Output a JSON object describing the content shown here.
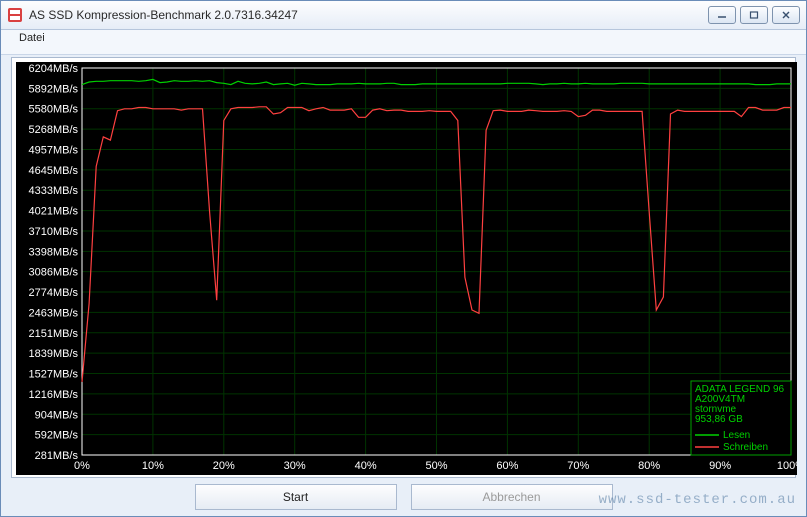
{
  "window": {
    "title": "AS SSD Kompression-Benchmark 2.0.7316.34247"
  },
  "menu": {
    "file": "Datei"
  },
  "buttons": {
    "start": "Start",
    "cancel": "Abbrechen"
  },
  "legend": {
    "device": "ADATA LEGEND 96",
    "model": "A200V4TM",
    "driver": "stornvme",
    "capacity": "953,86 GB",
    "read": "Lesen",
    "write": "Schreiben",
    "read_color": "#00d000",
    "write_color": "#ff4040",
    "grid_color": "#003300"
  },
  "watermark": "www.ssd-tester.com.au",
  "chart_data": {
    "type": "line",
    "xlabel": "",
    "ylabel": "",
    "x_ticks": [
      "0%",
      "10%",
      "20%",
      "30%",
      "40%",
      "50%",
      "60%",
      "70%",
      "80%",
      "90%",
      "100%"
    ],
    "y_ticks": [
      "281MB/s",
      "592MB/s",
      "904MB/s",
      "1216MB/s",
      "1527MB/s",
      "1839MB/s",
      "2151MB/s",
      "2463MB/s",
      "2774MB/s",
      "3086MB/s",
      "3398MB/s",
      "3710MB/s",
      "4021MB/s",
      "4333MB/s",
      "4645MB/s",
      "4957MB/s",
      "5268MB/s",
      "5580MB/s",
      "5892MB/s",
      "6204MB/s"
    ],
    "ylim": [
      281,
      6204
    ],
    "xlim": [
      0,
      100
    ],
    "x": [
      0,
      1,
      2,
      3,
      4,
      5,
      6,
      7,
      8,
      9,
      10,
      11,
      12,
      13,
      14,
      15,
      16,
      17,
      18,
      19,
      20,
      21,
      22,
      23,
      24,
      25,
      26,
      27,
      28,
      29,
      30,
      31,
      32,
      33,
      34,
      35,
      36,
      37,
      38,
      39,
      40,
      41,
      42,
      43,
      44,
      45,
      46,
      47,
      48,
      49,
      50,
      51,
      52,
      53,
      54,
      55,
      56,
      57,
      58,
      59,
      60,
      61,
      62,
      63,
      64,
      65,
      66,
      67,
      68,
      69,
      70,
      71,
      72,
      73,
      74,
      75,
      76,
      77,
      78,
      79,
      80,
      81,
      82,
      83,
      84,
      85,
      86,
      87,
      88,
      89,
      90,
      91,
      92,
      93,
      94,
      95,
      96,
      97,
      98,
      99,
      100
    ],
    "series": [
      {
        "name": "Lesen",
        "color": "#00d000",
        "values": [
          5950,
          5990,
          6000,
          6000,
          6010,
          6010,
          6010,
          6010,
          6000,
          6010,
          6030,
          5980,
          5990,
          6010,
          6000,
          6000,
          6010,
          6000,
          6010,
          5980,
          5970,
          5950,
          6000,
          5970,
          5960,
          5970,
          5990,
          5950,
          5960,
          5970,
          5940,
          5970,
          5960,
          5950,
          5950,
          5950,
          5960,
          5960,
          5960,
          5970,
          5960,
          5960,
          5960,
          5970,
          5970,
          5950,
          5950,
          5950,
          5960,
          5960,
          5960,
          5960,
          5960,
          5960,
          5960,
          5960,
          5960,
          5960,
          5960,
          5960,
          5970,
          5970,
          5970,
          5970,
          5960,
          5950,
          5960,
          5960,
          5970,
          5960,
          5960,
          5970,
          5960,
          5960,
          5960,
          5960,
          5970,
          5970,
          5970,
          5970,
          5960,
          5960,
          5960,
          5960,
          5960,
          5960,
          5960,
          5960,
          5960,
          5960,
          5960,
          5960,
          5960,
          5960,
          5960,
          5950,
          5950,
          5950,
          5960,
          5960,
          5960
        ]
      },
      {
        "name": "Schreiben",
        "color": "#ff4040",
        "values": [
          1400,
          2600,
          4700,
          5150,
          5100,
          5550,
          5580,
          5580,
          5600,
          5600,
          5580,
          5580,
          5580,
          5580,
          5560,
          5580,
          5580,
          5580,
          4000,
          2650,
          5400,
          5580,
          5600,
          5600,
          5600,
          5610,
          5610,
          5500,
          5520,
          5600,
          5600,
          5600,
          5550,
          5580,
          5600,
          5560,
          5560,
          5560,
          5580,
          5450,
          5450,
          5560,
          5580,
          5550,
          5560,
          5560,
          5540,
          5540,
          5540,
          5550,
          5540,
          5540,
          5540,
          5400,
          3000,
          2500,
          2450,
          5250,
          5550,
          5560,
          5540,
          5540,
          5540,
          5560,
          5550,
          5540,
          5540,
          5540,
          5550,
          5540,
          5460,
          5480,
          5560,
          5560,
          5540,
          5540,
          5540,
          5540,
          5540,
          5540,
          4000,
          2500,
          2700,
          5500,
          5560,
          5540,
          5540,
          5540,
          5540,
          5540,
          5540,
          5540,
          5540,
          5460,
          5600,
          5600,
          5560,
          5560,
          5560,
          5600,
          5600
        ]
      }
    ]
  }
}
